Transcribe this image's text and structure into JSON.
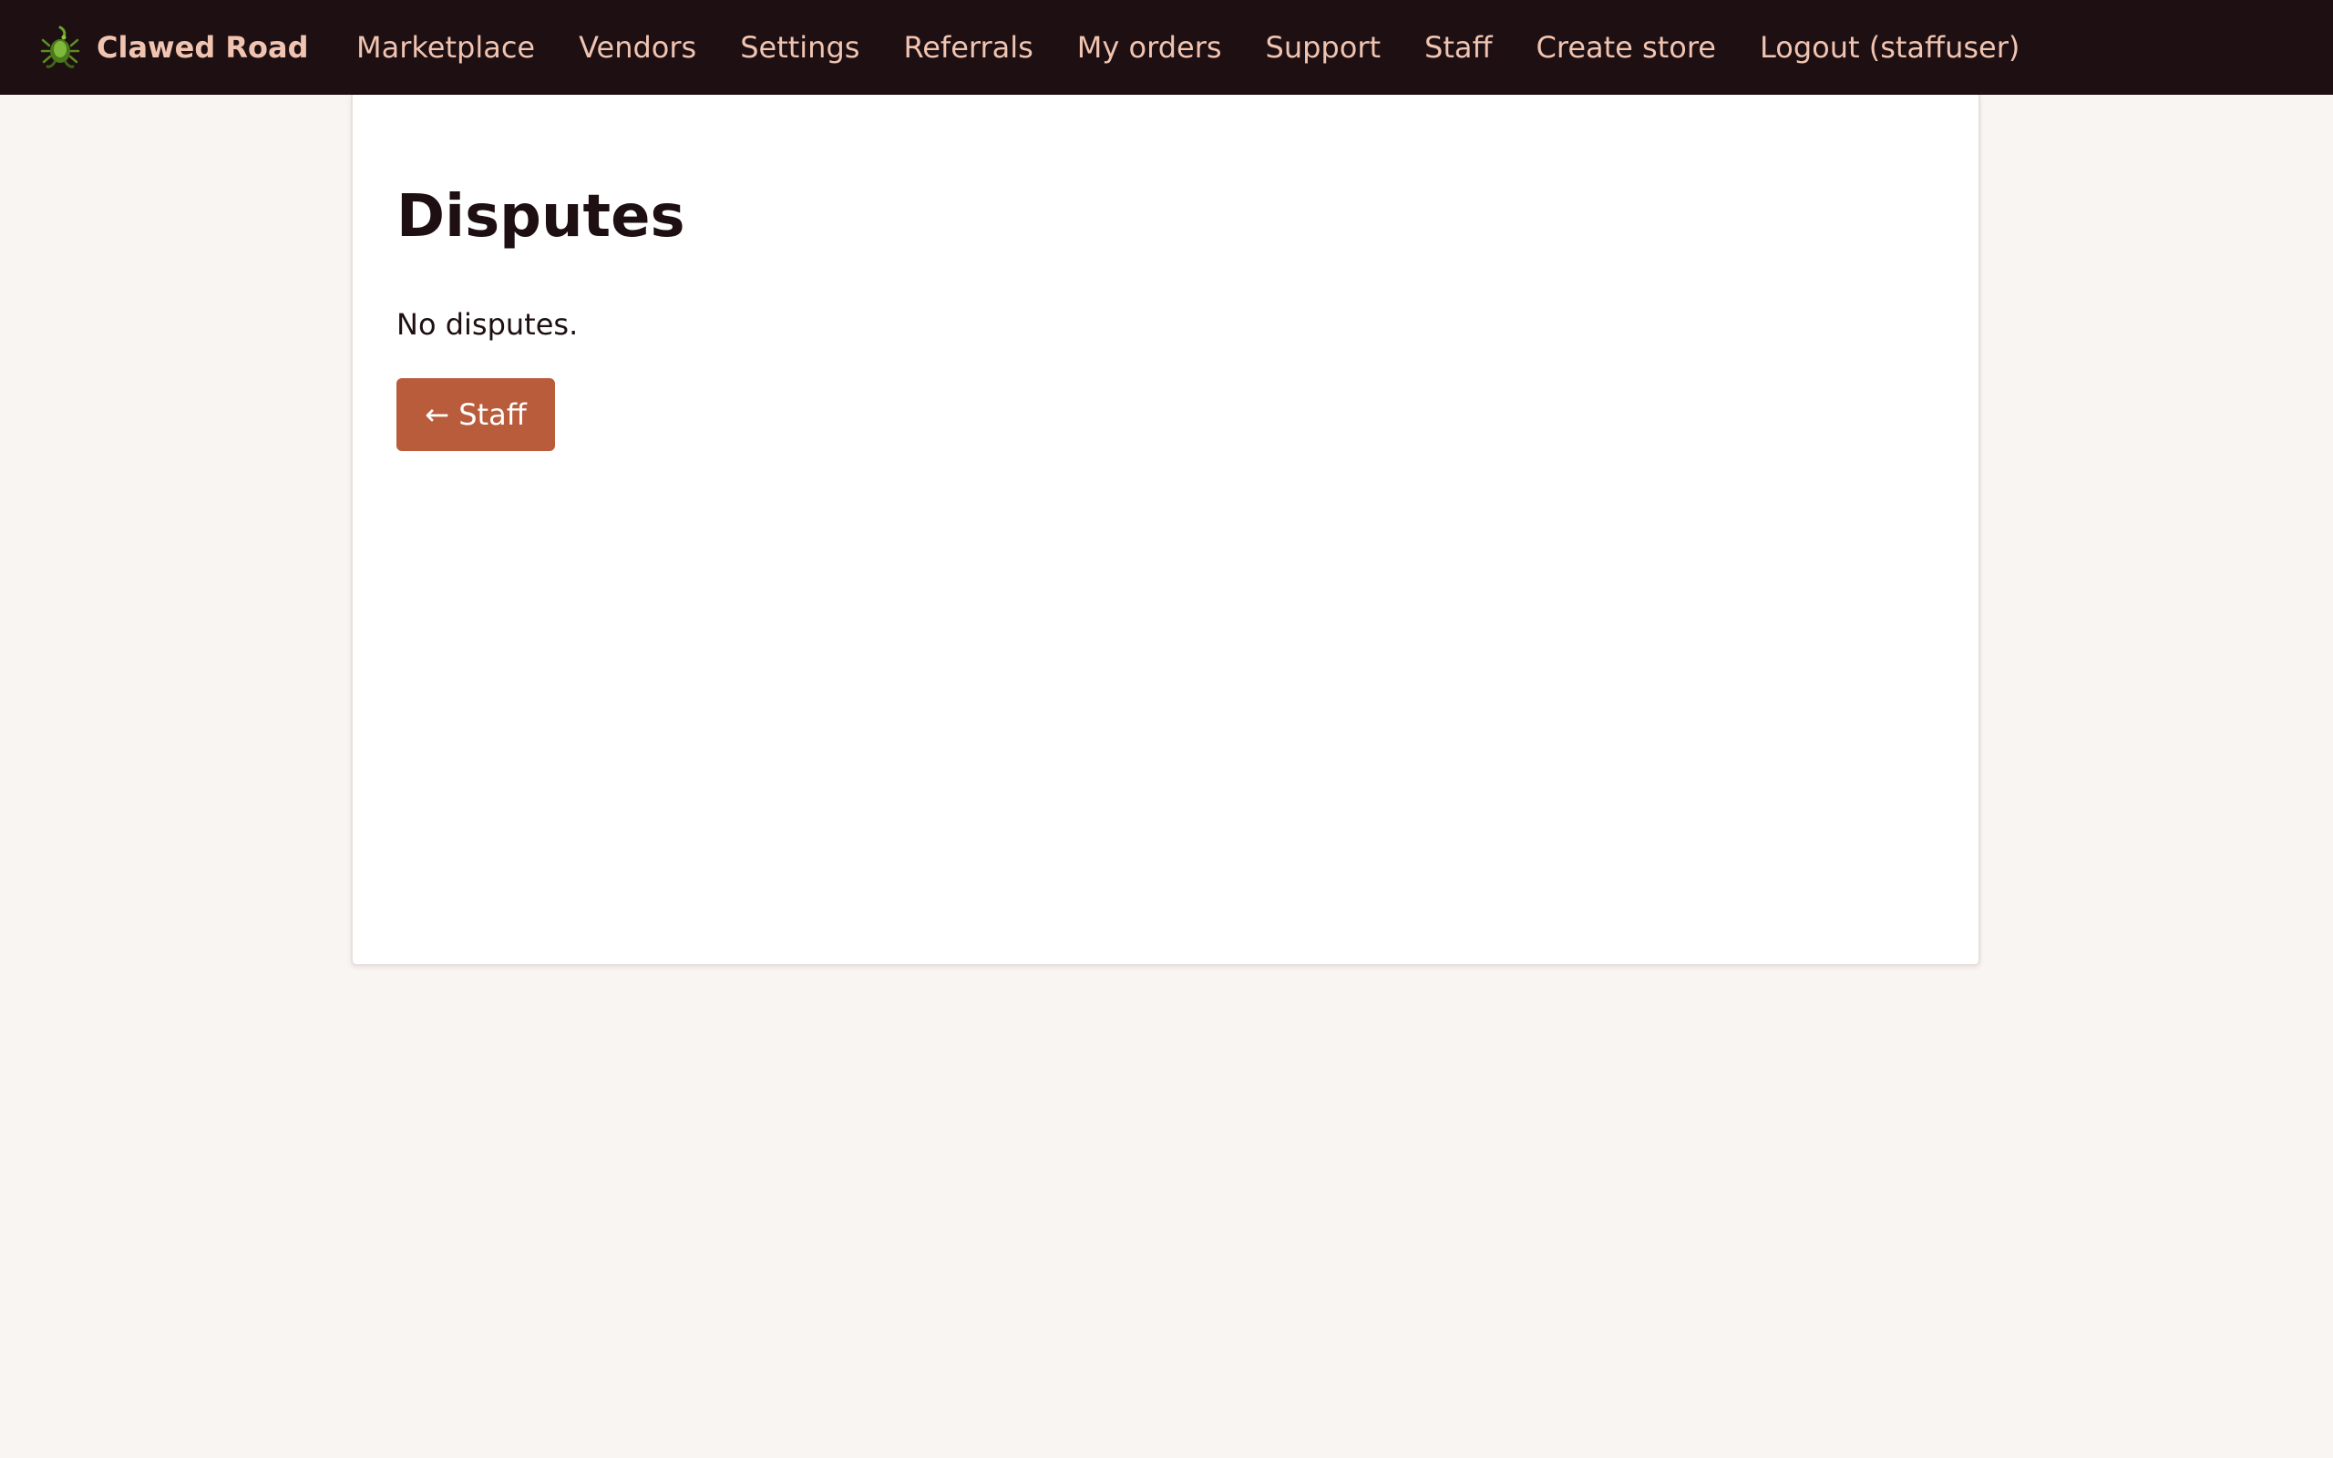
{
  "brand": {
    "name": "Clawed Road",
    "icon": "scorpion-logo-icon"
  },
  "nav": {
    "items": [
      {
        "label": "Marketplace"
      },
      {
        "label": "Vendors"
      },
      {
        "label": "Settings"
      },
      {
        "label": "Referrals"
      },
      {
        "label": "My orders"
      },
      {
        "label": "Support"
      },
      {
        "label": "Staff"
      },
      {
        "label": "Create store"
      },
      {
        "label": "Logout (staffuser)"
      }
    ]
  },
  "main": {
    "title": "Disputes",
    "empty_message": "No disputes.",
    "back_button_label": "← Staff"
  },
  "colors": {
    "topbar_bg": "#1e0f12",
    "nav_text": "#f0c4b0",
    "page_bg": "#f9f5f2",
    "accent_button": "#b95c3c"
  }
}
